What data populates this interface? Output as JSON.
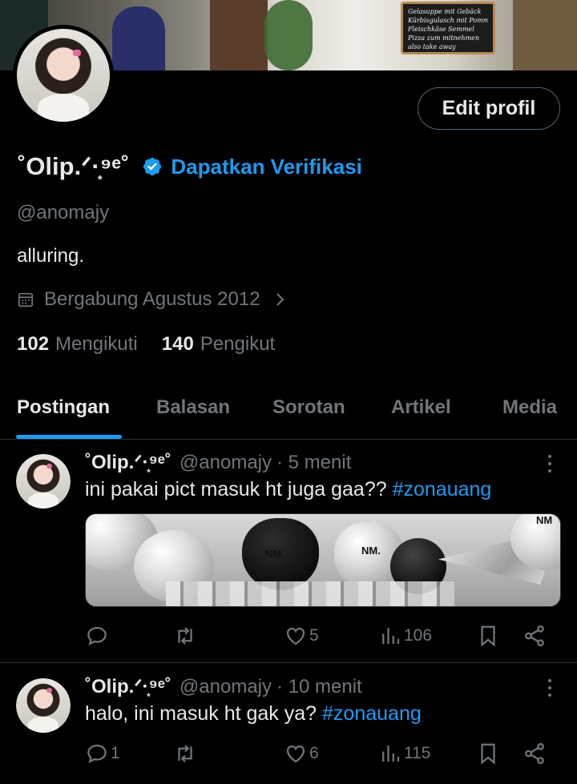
{
  "banner": {
    "menu_board_lines": [
      "Gelasuppe mit Gebäck",
      "Kürbisgulasch mit Pommes",
      "Fleischkäse Semmel",
      "Pizza zum mitnehmen",
      "also take away"
    ]
  },
  "profile": {
    "edit_label": "Edit profil",
    "display_name": "˚Olip.ᐟ·͙⁹ᵉ˚",
    "verify_label": "Dapatkan Verifikasi",
    "handle": "@anomajy",
    "bio": "alluring.",
    "joined": "Bergabung Agustus 2012",
    "following_count": "102",
    "following_label": "Mengikuti",
    "followers_count": "140",
    "followers_label": "Pengikut"
  },
  "tabs": [
    "Postingan",
    "Balasan",
    "Sorotan",
    "Artikel",
    "Media"
  ],
  "accent_color": "#1d9bf0",
  "posts": [
    {
      "name": "˚Olip.ᐟ·͙⁹ᵉ˚",
      "handle": "@anomajy",
      "time": "· 5 menit",
      "text": "ini pakai pict masuk ht juga gaa??",
      "hashtag": "#zonauang",
      "media_labels": [
        "NM.",
        "NM.",
        "NM"
      ],
      "replies": "",
      "reposts": "",
      "likes": "5",
      "views": "106"
    },
    {
      "name": "˚Olip.ᐟ·͙⁹ᵉ˚",
      "handle": "@anomajy",
      "time": "· 10 menit",
      "text": "halo, ini masuk ht gak ya?",
      "hashtag": "#zonauang",
      "replies": "1",
      "reposts": "",
      "likes": "6",
      "views": "115"
    }
  ]
}
